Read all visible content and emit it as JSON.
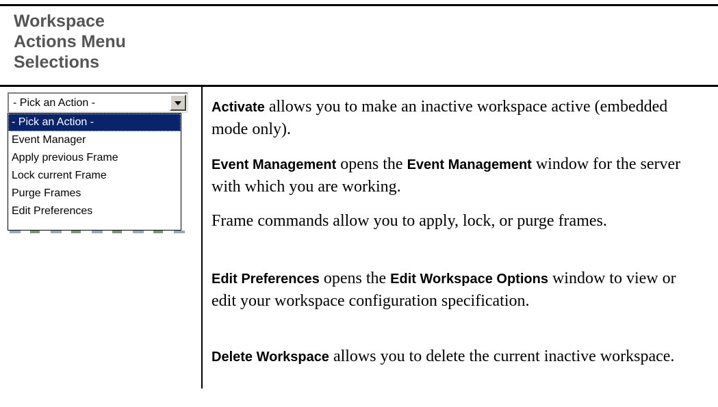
{
  "header": {
    "title_lines": [
      "Workspace",
      "Actions Menu",
      "Selections"
    ]
  },
  "dropdown": {
    "selected_value": "- Pick an Action -",
    "options": [
      "- Pick an Action -",
      "Event Manager",
      "Apply previous Frame",
      "Lock current Frame",
      "Purge Frames",
      "Edit Preferences"
    ]
  },
  "descriptions": {
    "activate": {
      "term": "Activate",
      "text": " allows you to make an inactive workspace active (embedded mode only)."
    },
    "event_management": {
      "term": "Event Management",
      "text1": " opens the ",
      "term2": "Event Management",
      "text2": " window for the server with which you are working."
    },
    "frame_commands": {
      "text": "Frame commands allow you to apply, lock, or purge frames."
    },
    "edit_preferences": {
      "term": "Edit Preferences",
      "text1": " opens the ",
      "term2": "Edit Workspace Options",
      "text2": " window to view or edit your workspace configuration specification."
    },
    "delete_workspace": {
      "term": "Delete Workspace",
      "text": " allows you to delete the current inactive workspace."
    }
  }
}
